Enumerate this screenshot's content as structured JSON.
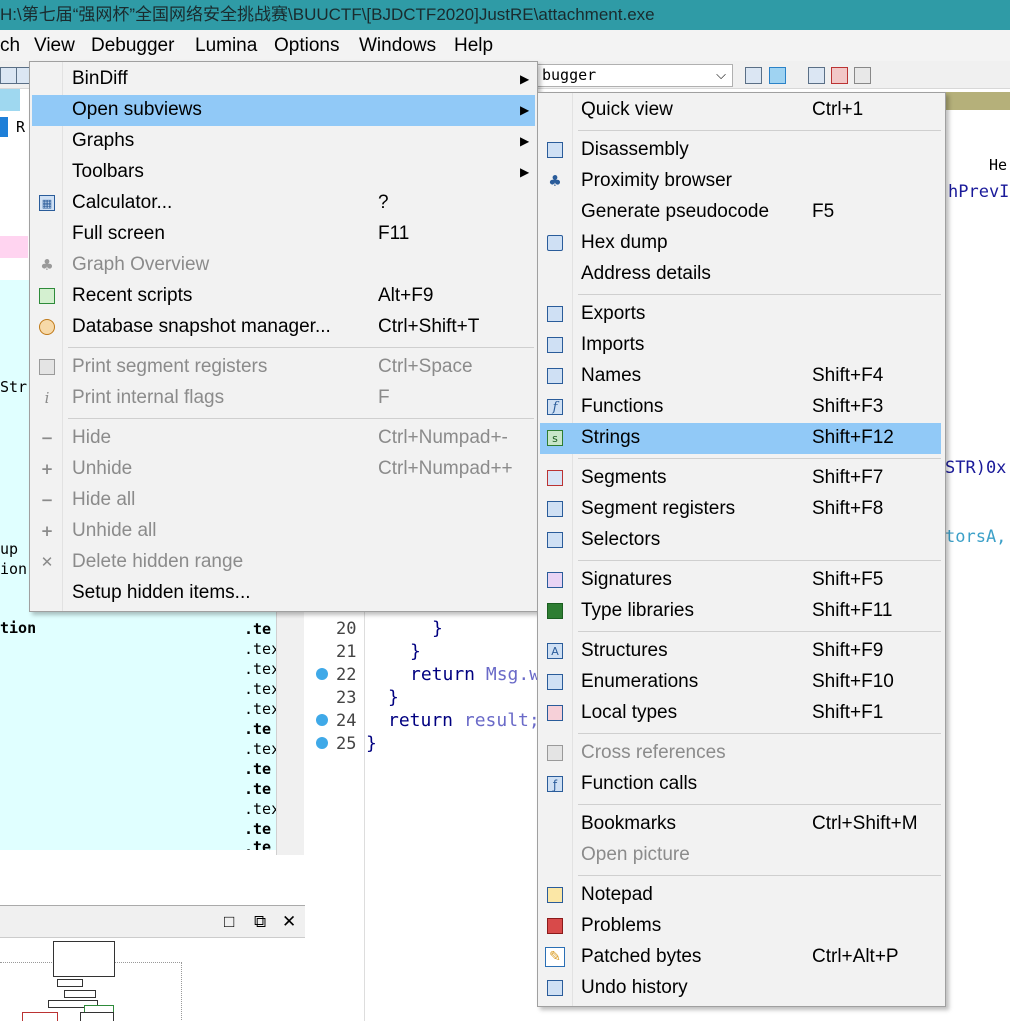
{
  "window": {
    "title": "H:\\第七届“强网杯”全国网络安全挑战赛\\BUUCTF\\[BJDCTF2020]JustRE\\attachment.exe"
  },
  "menubar": {
    "items": [
      "ch",
      "View",
      "Debugger",
      "Lumina",
      "Options",
      "Windows",
      "Help"
    ]
  },
  "toolbar": {
    "debugger_select_value": "bugger",
    "dropdown_arrow": "⌵"
  },
  "left_pane": {
    "header_fragment": "R",
    "fragments": [
      "Str",
      "up",
      "ion",
      "tion"
    ],
    "segments": [
      ".te",
      ".tex",
      ".tex",
      ".tex",
      ".tex",
      ".te",
      ".tex",
      ".te",
      ".te",
      ".tex",
      ".te",
      ".te"
    ]
  },
  "graph_pane": {
    "buttons": [
      "□",
      "⧉",
      "✕"
    ]
  },
  "code_pane": {
    "header_right": "He:",
    "peeks": [
      "hPrevI",
      "STR)0x",
      "torsA,"
    ],
    "line_numbers": [
      "20",
      "21",
      "22",
      "23",
      "24",
      "25"
    ],
    "lines": [
      {
        "text": "}"
      },
      {
        "text": "}"
      },
      {
        "keyword": "return ",
        "var": "Msg.w"
      },
      {
        "text": "}"
      },
      {
        "keyword": "return ",
        "var": "result;"
      },
      {
        "text": "}"
      }
    ]
  },
  "view_menu": {
    "items": [
      {
        "label": "BinDiff",
        "shortcut": "",
        "submenu": true
      },
      {
        "label": "Open subviews",
        "shortcut": "",
        "submenu": true
      },
      {
        "label": "Graphs",
        "shortcut": "",
        "submenu": true
      },
      {
        "label": "Toolbars",
        "shortcut": "",
        "submenu": true
      },
      {
        "label": "Calculator...",
        "shortcut": "?"
      },
      {
        "label": "Full screen",
        "shortcut": "F11"
      },
      {
        "label": "Graph Overview",
        "shortcut": ""
      },
      {
        "label": "Recent scripts",
        "shortcut": "Alt+F9"
      },
      {
        "label": "Database snapshot manager...",
        "shortcut": "Ctrl+Shift+T"
      },
      {
        "label": "Print segment registers",
        "shortcut": "Ctrl+Space"
      },
      {
        "label": "Print internal flags",
        "shortcut": "F"
      },
      {
        "label": "Hide",
        "shortcut": "Ctrl+Numpad+-"
      },
      {
        "label": "Unhide",
        "shortcut": "Ctrl+Numpad++"
      },
      {
        "label": "Hide all",
        "shortcut": ""
      },
      {
        "label": "Unhide all",
        "shortcut": ""
      },
      {
        "label": "Delete hidden range",
        "shortcut": ""
      },
      {
        "label": "Setup hidden items...",
        "shortcut": ""
      }
    ],
    "submenu_arrow": "▶"
  },
  "subviews_menu": {
    "items": [
      {
        "label": "Quick view",
        "shortcut": "Ctrl+1"
      },
      {
        "label": "Disassembly",
        "shortcut": ""
      },
      {
        "label": "Proximity browser",
        "shortcut": ""
      },
      {
        "label": "Generate pseudocode",
        "shortcut": "F5"
      },
      {
        "label": "Hex dump",
        "shortcut": ""
      },
      {
        "label": "Address details",
        "shortcut": ""
      },
      {
        "label": "Exports",
        "shortcut": ""
      },
      {
        "label": "Imports",
        "shortcut": ""
      },
      {
        "label": "Names",
        "shortcut": "Shift+F4"
      },
      {
        "label": "Functions",
        "shortcut": "Shift+F3"
      },
      {
        "label": "Strings",
        "shortcut": "Shift+F12"
      },
      {
        "label": "Segments",
        "shortcut": "Shift+F7"
      },
      {
        "label": "Segment registers",
        "shortcut": "Shift+F8"
      },
      {
        "label": "Selectors",
        "shortcut": ""
      },
      {
        "label": "Signatures",
        "shortcut": "Shift+F5"
      },
      {
        "label": "Type libraries",
        "shortcut": "Shift+F11"
      },
      {
        "label": "Structures",
        "shortcut": "Shift+F9"
      },
      {
        "label": "Enumerations",
        "shortcut": "Shift+F10"
      },
      {
        "label": "Local types",
        "shortcut": "Shift+F1"
      },
      {
        "label": "Cross references",
        "shortcut": ""
      },
      {
        "label": "Function calls",
        "shortcut": ""
      },
      {
        "label": "Bookmarks",
        "shortcut": "Ctrl+Shift+M"
      },
      {
        "label": "Open picture",
        "shortcut": ""
      },
      {
        "label": "Notepad",
        "shortcut": ""
      },
      {
        "label": "Problems",
        "shortcut": ""
      },
      {
        "label": "Patched bytes",
        "shortcut": "Ctrl+Alt+P"
      },
      {
        "label": "Undo history",
        "shortcut": ""
      }
    ]
  },
  "icon_glyphs": {
    "calculator": "▦",
    "graph": "♣",
    "info": "i",
    "minus": "−",
    "plus": "+",
    "cross": "✕",
    "functions": "f",
    "strings": "s",
    "structures": "A",
    "pencil": "✎",
    "fcalls": "ƒ"
  },
  "colors": {
    "title_bar": "#2f9ba6",
    "menu_highlight": "#91c9f7",
    "disabled_text": "#8b8b8b",
    "left_pane_bg": "#e0ffff",
    "breakpoint": "#3fa9e8"
  }
}
